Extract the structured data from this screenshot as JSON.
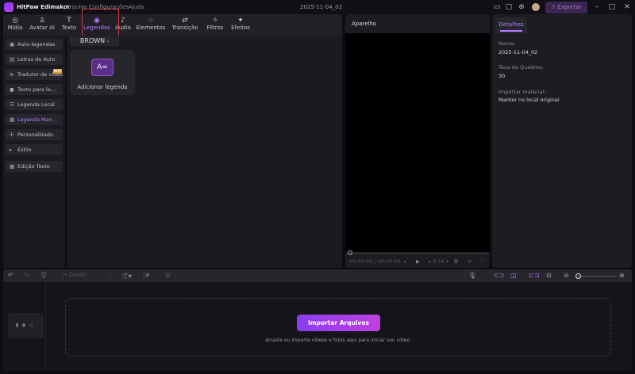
{
  "app": {
    "title": "HitPaw Edimakor",
    "menu": [
      "Arquivo",
      "Configurações",
      "Ajuda"
    ],
    "project_date": "2025-11-04_02",
    "export_label": "Exportar"
  },
  "tabs": [
    {
      "label": "Mídia",
      "icon": "media"
    },
    {
      "label": "Avatar AI",
      "icon": "avatar"
    },
    {
      "label": "Texto",
      "icon": "text"
    },
    {
      "label": "Legendas",
      "icon": "subtitles",
      "active": true
    },
    {
      "label": "Áudio",
      "icon": "music"
    },
    {
      "label": "Elementos",
      "icon": "elements"
    },
    {
      "label": "Transição",
      "icon": "transition"
    },
    {
      "label": "Filtros",
      "icon": "filters"
    },
    {
      "label": "Efeitos",
      "icon": "effects"
    }
  ],
  "sidebar": {
    "items": [
      {
        "label": "Auto-legendas"
      },
      {
        "label": "Letras de Auto"
      },
      {
        "label": "Tradutor de vídeo",
        "badge": "NEW"
      },
      {
        "label": "Texto para le..."
      },
      {
        "label": "Legenda Local"
      },
      {
        "label": "Legenda Man...",
        "active": true
      },
      {
        "label": "Personalizado"
      },
      {
        "label": "Estilo"
      },
      {
        "label": "Edição Texto"
      }
    ]
  },
  "content": {
    "filter": "BROWN",
    "card_label": "Adicionar legenda"
  },
  "preview": {
    "title": "Aparelho",
    "time": "00:00:00 / 00:00:00",
    "ratio": "9:16"
  },
  "details": {
    "tab": "Detalhes",
    "name_label": "Nome:",
    "name_value": "2025-11-04_02",
    "fps_label": "Taxa de Quadros:",
    "fps_value": "30",
    "import_label": "Importar material:",
    "import_value": "Manter no local original"
  },
  "timeline": {
    "split_label": "Dividir",
    "import_button": "Importar Arquivos",
    "hint": "Arraste ou importe vídeos e fotos aqui para iniciar seu vídeo."
  },
  "colors": {
    "accent": "#b27cff",
    "highlight_box": "#d23a3a"
  }
}
